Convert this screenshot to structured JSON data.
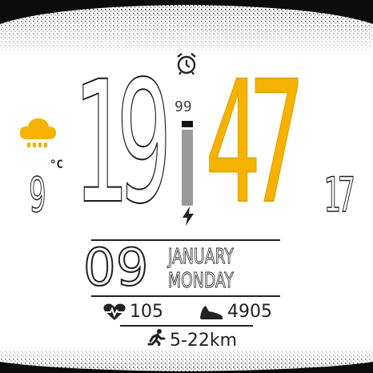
{
  "time": {
    "hour": "19",
    "minute": "47"
  },
  "battery": {
    "percent": "99",
    "level": 0.99,
    "charging_icon": "bolt-icon"
  },
  "alarm": {
    "icon": "alarm-clock-icon"
  },
  "weather": {
    "icon": "rain-cloud-icon",
    "unit": "°C",
    "temperature": "9"
  },
  "right_value": "17",
  "date": {
    "day": "09",
    "month": "JANUARY",
    "weekday": "MONDAY"
  },
  "stats": {
    "heart_rate": {
      "icon": "heart-rate-icon",
      "value": "105"
    },
    "steps": {
      "icon": "shoe-icon",
      "value": "4905"
    },
    "distance": {
      "icon": "runner-icon",
      "value": "5-22km"
    }
  },
  "colors": {
    "accent": "#f6b200",
    "text": "#222222",
    "battery_fill": "#9a9a9a"
  }
}
